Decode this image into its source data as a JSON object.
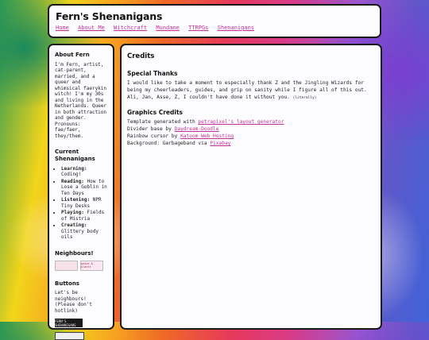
{
  "header": {
    "title": "Fern's Shenanigans",
    "nav": [
      "Home",
      "About Me",
      "Witchcraft",
      "Mundane",
      "TTRPGs",
      "Shenanigans"
    ]
  },
  "sidebar": {
    "about": {
      "heading": "About Fern",
      "text": "I'm Fern, artist, cat-parent, married, and a queer and whimsical faerykin witch! I'm my 30s and living in the Netherlands. Queer in both attraction and gender. Pronouns: fae/faer, they/them."
    },
    "current": {
      "heading": "Current Shenanigans",
      "items": [
        {
          "label": "Learning:",
          "value": "Coding!"
        },
        {
          "label": "Reading:",
          "value": "How to Lose a Goblin in Ten Days"
        },
        {
          "label": "Listening:",
          "value": "NPR Tiny Desks"
        },
        {
          "label": "Playing:",
          "value": "Fields of Mistria"
        },
        {
          "label": "Creating:",
          "value": "Glittery body oils"
        }
      ]
    },
    "neighbours": {
      "heading": "Neighbours!",
      "badge_b": "peace & plants"
    },
    "buttons": {
      "heading": "Buttons",
      "text": "Let's be neighbours! (Please don't hotlink)",
      "button_text": "FERN'S SHENANIGANS"
    }
  },
  "main": {
    "title": "Credits",
    "thanks": {
      "heading": "Special Thanks",
      "text": "I would like to take a moment to especially thank Z and the Jingling Wizards for being my cheerleaders, guides, and grip on sanity while I figure all of this out. Ali, Jan, Asse, Z, I couldn't have done it without you.",
      "note": "(literally)"
    },
    "graphics": {
      "heading": "Graphics Credits",
      "lines": [
        {
          "prefix": "Template generated with ",
          "link": "petrapixel's layout generator"
        },
        {
          "prefix": "Divider base by ",
          "link": "Daydream-Doodle"
        },
        {
          "prefix": "Rainbow cursor by ",
          "link": "Katoom Web Hosting"
        },
        {
          "prefix": "Background: Garbageband via ",
          "link": "Pixabay"
        }
      ]
    }
  },
  "colors": {
    "link": "#c0309a",
    "panel": "#fdfcff",
    "border": "#1a1a1a"
  }
}
